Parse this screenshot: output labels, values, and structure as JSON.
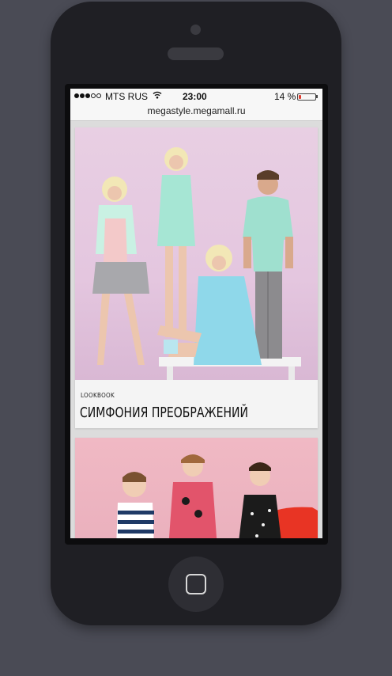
{
  "status_bar": {
    "carrier": "MTS RUS",
    "time": "23:00",
    "battery_percent_label": "14 %",
    "battery_level": 0.14,
    "signal_bars_filled": 3,
    "signal_bars_total": 5
  },
  "browser": {
    "url": "megastyle.megamall.ru"
  },
  "feed": {
    "cards": [
      {
        "tag": "LOOKBOOK",
        "title": "СИМФОНИЯ ПРЕОБРАЖЕНИЙ"
      }
    ]
  },
  "colors": {
    "page_background": "#4a4b55",
    "phone_body": "#1f1f24",
    "card1_photo_bg": "#e8cfe3",
    "card2_photo_bg": "#f0b9c4",
    "battery_low": "#e23b2f"
  },
  "icons": {
    "wifi": "wifi-icon",
    "battery": "battery-icon",
    "home": "home-button-square"
  }
}
